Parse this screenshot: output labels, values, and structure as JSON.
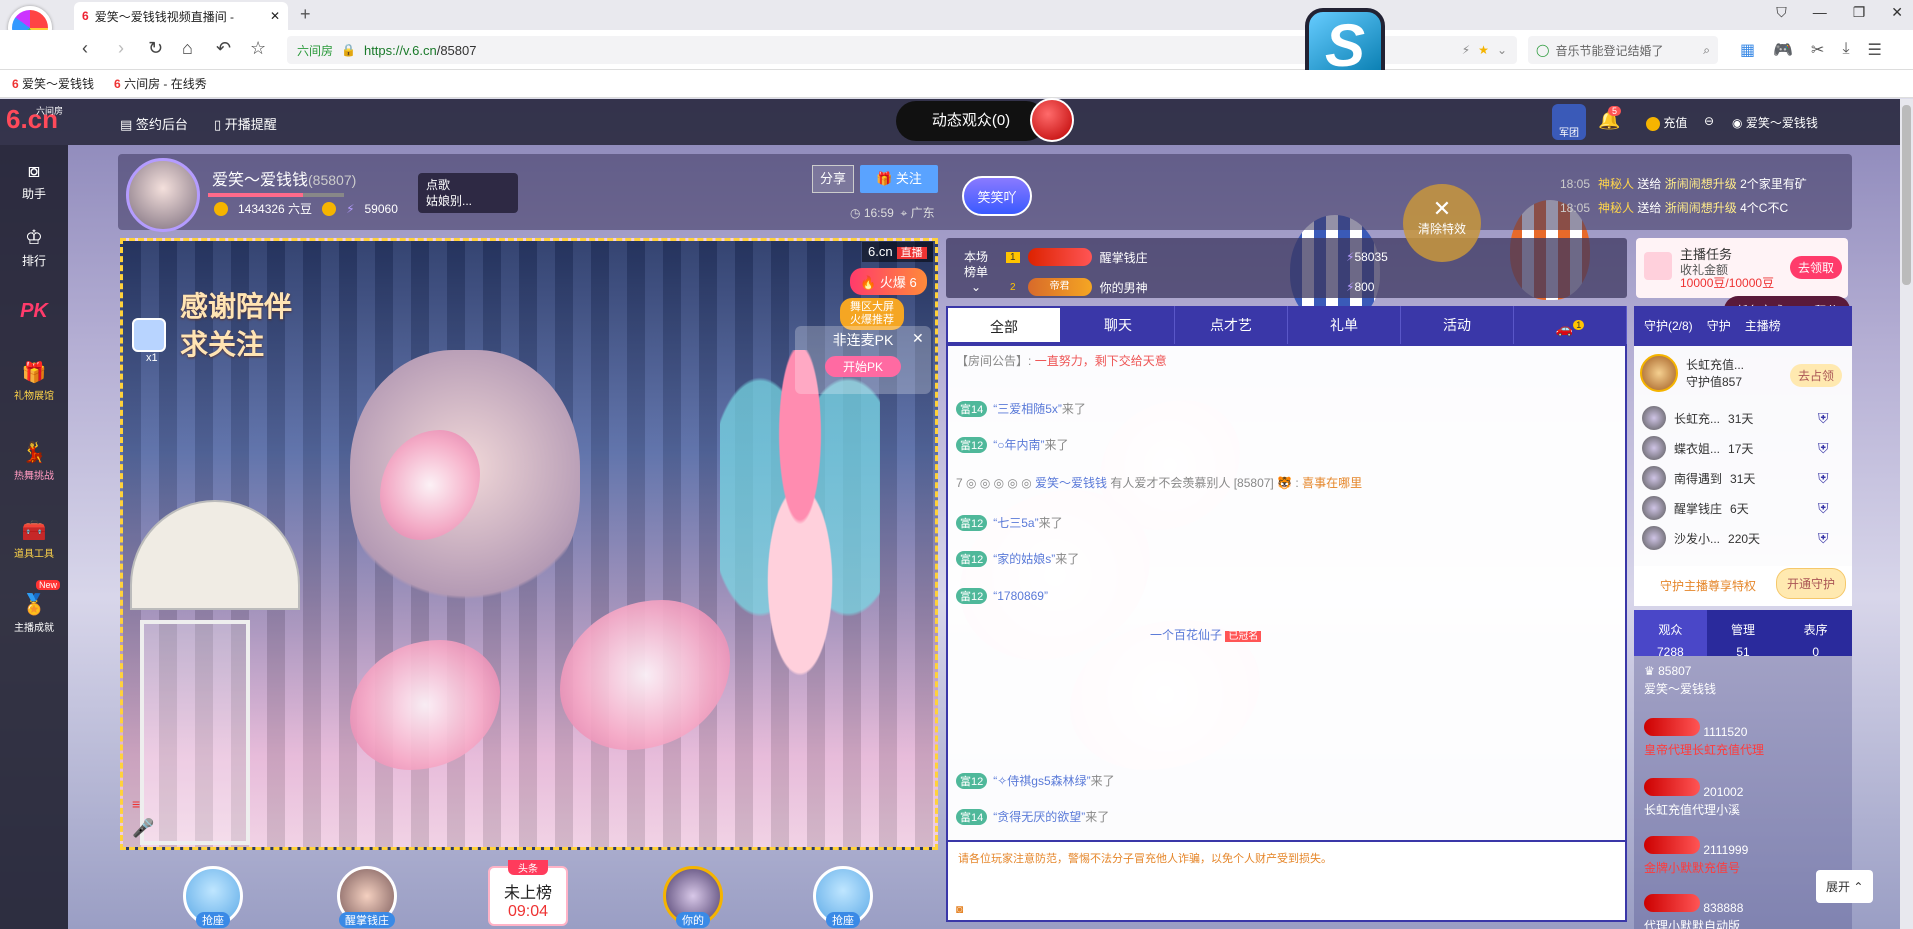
{
  "browser": {
    "tab_title": "爱笑～爱钱钱视频直播间 -",
    "new_tab": "+",
    "url_host": "https://v.6.cn",
    "url_path": "/85807",
    "site_badge": "六间房",
    "search_placeholder": "音乐节能登记结婚了",
    "bookmarks": [
      "爱笑～爱钱钱",
      "六间房 - 在线秀"
    ]
  },
  "site": {
    "logo_main": "6.cn",
    "logo_sub": "六间房",
    "top_nav": [
      "签约后台",
      "开播提醒"
    ],
    "dynamic_audience": "动态观众(0)",
    "right_nav": {
      "army": "军团",
      "badge_count": "5",
      "recharge": "充值",
      "user": "爱笑～爱钱钱"
    }
  },
  "sidebar": [
    {
      "label": "助手",
      "icon": "assistant-icon"
    },
    {
      "label": "排行",
      "icon": "crown-icon"
    },
    {
      "label": "PK",
      "icon": "pk-icon"
    },
    {
      "label": "礼物展馆",
      "icon": "gift-icon"
    },
    {
      "label": "热舞挑战",
      "icon": "dance-icon"
    },
    {
      "label": "道具工具",
      "icon": "tools-icon"
    },
    {
      "label": "主播成就",
      "icon": "achievement-icon",
      "badge": "New"
    }
  ],
  "anchor": {
    "name": "爱笑～爱钱钱",
    "room_id": "(85807)",
    "beans": "1434326 六豆",
    "fans": "59060",
    "song_label": "点歌",
    "song_name": "姑娘别...",
    "share": "分享",
    "follow": "关注",
    "time": "16:59",
    "location": "广东",
    "smile_badge": "笑笑吖"
  },
  "gift_log": [
    {
      "time": "18:05",
      "user": "神秘人",
      "verb": "送给",
      "target": "浙闹闹想升级",
      "gift": "2个家里有矿"
    },
    {
      "time": "18:05",
      "user": "神秘人",
      "verb": "送给",
      "target": "浙闹闹想升级",
      "gift": "4个C不C"
    }
  ],
  "video": {
    "live_site": "6.cn",
    "live_tag": "直播",
    "hot": "火爆",
    "hot_level": "6",
    "push_line1": "舞区大屏",
    "push_line2": "火爆推荐",
    "thanks1": "感谢陪伴",
    "thanks2": "求关注",
    "pk_title": "非连麦PK",
    "pk_start": "开始PK",
    "mult": "x1"
  },
  "seats": [
    {
      "label": "抢座"
    },
    {
      "label": "醒掌钱庄"
    },
    {
      "label": "你的"
    },
    {
      "label": "抢座"
    }
  ],
  "rank_card": {
    "head": "头条",
    "status": "未上榜",
    "time": "09:04"
  },
  "board": {
    "title1": "本场",
    "title2": "榜单",
    "rows": [
      {
        "rank": "1",
        "name": "醒掌钱庄",
        "value": "58035"
      },
      {
        "rank": "2",
        "tag": "帝君",
        "name": "你的男神",
        "value": "800"
      }
    ]
  },
  "clear_fx": "清除特效",
  "task": {
    "title": "主播任务",
    "line1": "收礼金额",
    "line2": "10000豆/10000豆",
    "go": "去领取",
    "done": "任务完成 +150积分"
  },
  "chat_tabs": [
    "全部",
    "聊天",
    "点才艺",
    "礼单",
    "活动",
    "1"
  ],
  "chat": [
    {
      "type": "notice",
      "label": "【房间公告】:",
      "text": "一直努力，剩下交给天意"
    },
    {
      "type": "enter",
      "level": "富14",
      "name": "“三爱相随5x”",
      "verb": "来了"
    },
    {
      "type": "enter",
      "level": "富12",
      "name": "“○年内南”",
      "verb": "来了"
    },
    {
      "type": "chat",
      "name": "爱笑～爱钱钱",
      "text": "有人爱才不会羡慕别人 [85807]",
      "reply": "喜事在哪里"
    },
    {
      "type": "enter",
      "level": "富12",
      "name": "“七三5a”",
      "verb": "来了"
    },
    {
      "type": "enter",
      "level": "富12",
      "name": "“家的姑娘s”",
      "verb": "来了"
    },
    {
      "type": "enter",
      "level": "富12",
      "name": "“1780869”",
      "verb": ""
    },
    {
      "type": "enter",
      "level": "",
      "name": "一个百花仙子",
      "verb": "已冠名"
    },
    {
      "type": "enter",
      "level": "富12",
      "name": "“✧侍祺gs5森林绿”",
      "verb": "来了"
    },
    {
      "type": "enter",
      "level": "富14",
      "name": "“贪得无厌的欲望”",
      "verb": "来了"
    }
  ],
  "chat_warning": "请各位玩家注意防范，警惕不法分子冒充他人诈骗，以免个人财产受到损失。",
  "guard": {
    "tabs": [
      "守护(2/8)",
      "守护",
      "主播榜"
    ],
    "top": {
      "name": "长虹充值...",
      "value": "守护值857",
      "action": "去占领"
    },
    "rows": [
      {
        "name": "长虹充...",
        "days": "31天"
      },
      {
        "name": "蝶衣姐...",
        "days": "17天"
      },
      {
        "name": "南得遇到",
        "days": "31天"
      },
      {
        "name": "醒掌钱庄",
        "days": "6天"
      },
      {
        "name": "沙发小...",
        "days": "220天"
      }
    ],
    "footer": "守护主播尊享特权",
    "open": "开通守护"
  },
  "audience": {
    "tabs": [
      {
        "label": "观众",
        "value": "7288"
      },
      {
        "label": "管理",
        "value": "51"
      },
      {
        "label": "表序",
        "value": "0"
      }
    ],
    "rows": [
      {
        "id": "85807",
        "name": "爱笑～爱钱钱",
        "sub": ""
      },
      {
        "id": "1111520",
        "name": "",
        "sub": "皇帝代理长虹充值代理"
      },
      {
        "id": "201002",
        "name": "长虹充值代理小溪",
        "sub": ""
      },
      {
        "id": "2111999",
        "name": "",
        "sub": "金牌小默默充值号"
      },
      {
        "id": "838888",
        "name": "代理小默默自动版",
        "sub": ""
      }
    ],
    "expand": "展开"
  }
}
